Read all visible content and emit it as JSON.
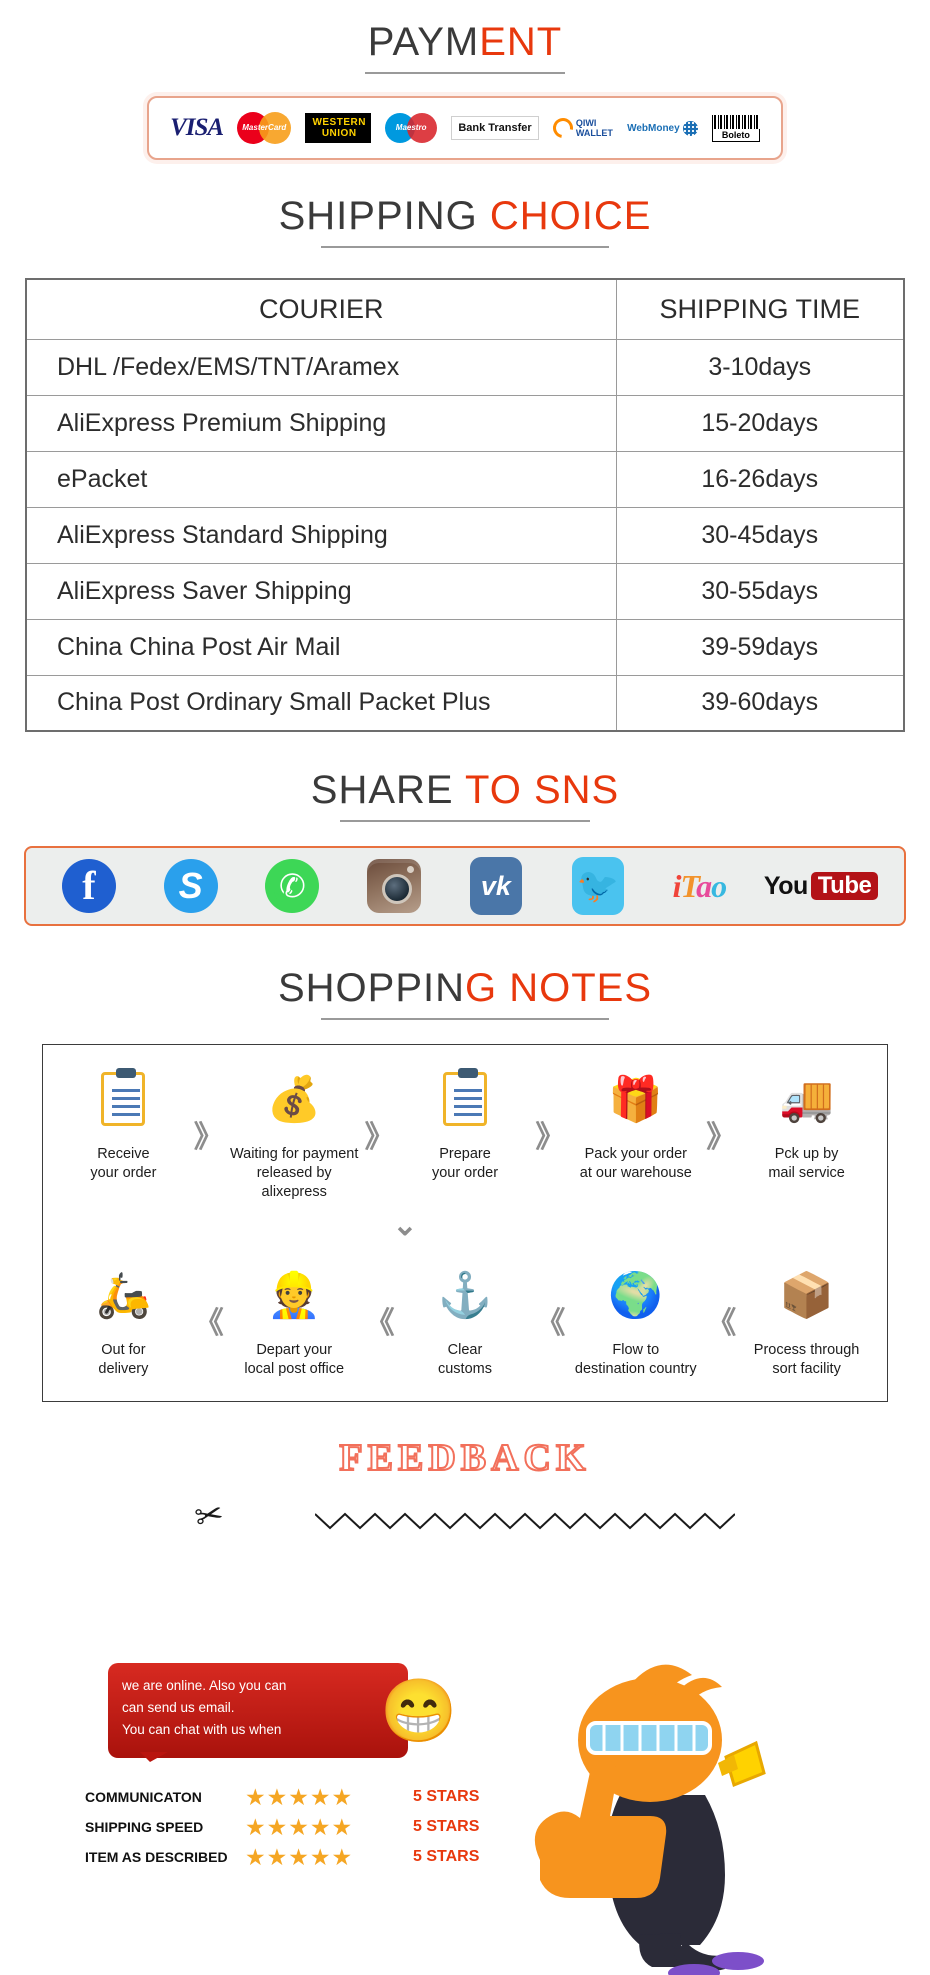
{
  "sections": {
    "payment": {
      "dark": "PAYM",
      "red": "ENT"
    },
    "shipping": {
      "dark": "SHIPPING",
      "red": " CHOICE"
    },
    "sns": {
      "dark": "SHARE",
      "red": " TO SNS"
    },
    "notes": {
      "dark": "SHOPPIN",
      "red": "G NOTES"
    },
    "feedback": {
      "title": "FEEDBACK"
    }
  },
  "payment_methods": [
    {
      "name": "visa-logo",
      "label": "VISA"
    },
    {
      "name": "mastercard-logo",
      "label": "MasterCard"
    },
    {
      "name": "western-union-logo",
      "line1": "WESTERN",
      "line2": "UNION"
    },
    {
      "name": "maestro-logo",
      "label": "Maestro"
    },
    {
      "name": "bank-transfer-logo",
      "label": "Bank Transfer"
    },
    {
      "name": "qiwi-wallet-logo",
      "line1": "QIWI",
      "line2": "WALLET"
    },
    {
      "name": "webmoney-logo",
      "label": "WebMoney"
    },
    {
      "name": "boleto-logo",
      "label": "Boleto"
    }
  ],
  "shipping_table": {
    "headers": [
      "COURIER",
      "SHIPPING TIME"
    ],
    "rows": [
      {
        "courier": "DHL /Fedex/EMS/TNT/Aramex",
        "time": "3-10days"
      },
      {
        "courier": "AliExpress Premium Shipping",
        "time": "15-20days"
      },
      {
        "courier": "ePacket",
        "time": "16-26days"
      },
      {
        "courier": "AliExpress Standard Shipping",
        "time": "30-45days"
      },
      {
        "courier": "AliExpress Saver Shipping",
        "time": "30-55days"
      },
      {
        "courier": "China China Post Air Mail",
        "time": "39-59days"
      },
      {
        "courier": "China Post Ordinary Small Packet Plus",
        "time": "39-60days"
      }
    ]
  },
  "social": [
    {
      "name": "facebook-icon",
      "label": "f"
    },
    {
      "name": "skype-icon",
      "label": "S"
    },
    {
      "name": "whatsapp-icon",
      "label": "✆"
    },
    {
      "name": "instagram-icon",
      "label": "Instagram"
    },
    {
      "name": "vk-icon",
      "label": "vk"
    },
    {
      "name": "twitter-icon",
      "label": "🐦"
    },
    {
      "name": "itao-icon",
      "label": "iTao"
    },
    {
      "name": "youtube-icon",
      "you": "You",
      "tube": "Tube"
    }
  ],
  "notes_steps_row1": [
    {
      "icon": "clipboard-icon",
      "line1": "Receive",
      "line2": "your order"
    },
    {
      "icon": "money-bag-icon",
      "line1": "Waiting for payment",
      "line2": "released by alixepress"
    },
    {
      "icon": "clipboard-icon",
      "line1": "Prepare",
      "line2": "your order"
    },
    {
      "icon": "gift-box-icon",
      "line1": "Pack your order",
      "line2": "at our warehouse"
    },
    {
      "icon": "truck-icon",
      "line1": "Pck up by",
      "line2": "mail service"
    }
  ],
  "notes_steps_row2": [
    {
      "icon": "scooter-icon",
      "line1": "Out for",
      "line2": "delivery"
    },
    {
      "icon": "postman-icon",
      "line1": "Depart your",
      "line2": "local post office"
    },
    {
      "icon": "anchor-icon",
      "line1": "Clear",
      "line2": "customs"
    },
    {
      "icon": "globe-icon",
      "line1": "Flow to",
      "line2": "destination country"
    },
    {
      "icon": "cart-boxes-icon",
      "line1": "Process through",
      "line2": "sort facility"
    }
  ],
  "notes_arrow": "》",
  "notes_arrow_down": "⌄",
  "feedback": {
    "bubble_lines": [
      "we are online. Also you can",
      "can send us email.",
      "You can chat with us when"
    ],
    "emoji": "😁",
    "ratings": [
      {
        "name": "COMMUNICATON",
        "stars": "★★★★★",
        "value": "5 STARS"
      },
      {
        "name": "SHIPPING SPEED",
        "stars": "★★★★★",
        "value": "5 STARS"
      },
      {
        "name": "ITEM AS DESCRIBED",
        "stars": "★★★★★",
        "value": "5 STARS"
      }
    ]
  },
  "colors": {
    "accent_red": "#e8380d",
    "dark_text": "#3a3a3a",
    "star_gold": "#f5a623"
  }
}
